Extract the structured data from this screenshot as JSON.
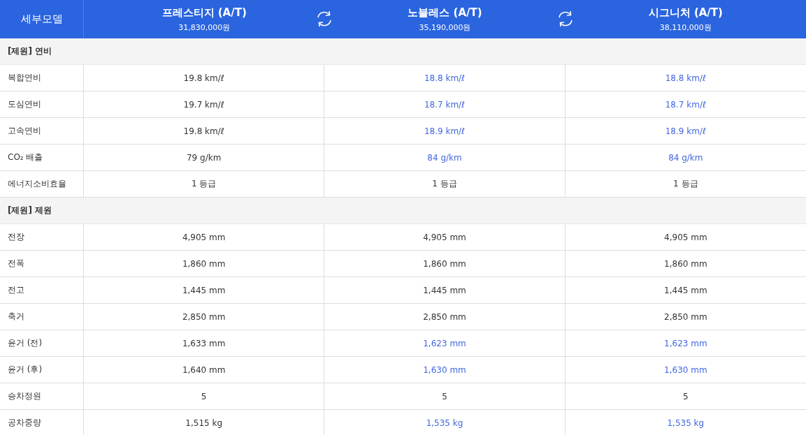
{
  "header": {
    "label": "세부모델",
    "models": [
      {
        "name": "프레스티지 (A/T)",
        "price": "31,830,000원"
      },
      {
        "name": "노블레스 (A/T)",
        "price": "35,190,000원"
      },
      {
        "name": "시그니처 (A/T)",
        "price": "38,110,000원"
      }
    ]
  },
  "sections": [
    {
      "title": "[제원] 연비",
      "rows": [
        {
          "label": "복합연비",
          "values": [
            {
              "text": "19.8 km/ℓ",
              "changed": false
            },
            {
              "text": "18.8 km/ℓ",
              "changed": true
            },
            {
              "text": "18.8 km/ℓ",
              "changed": true
            }
          ]
        },
        {
          "label": "도심연비",
          "values": [
            {
              "text": "19.7 km/ℓ",
              "changed": false
            },
            {
              "text": "18.7 km/ℓ",
              "changed": true
            },
            {
              "text": "18.7 km/ℓ",
              "changed": true
            }
          ]
        },
        {
          "label": "고속연비",
          "values": [
            {
              "text": "19.8 km/ℓ",
              "changed": false
            },
            {
              "text": "18.9 km/ℓ",
              "changed": true
            },
            {
              "text": "18.9 km/ℓ",
              "changed": true
            }
          ]
        },
        {
          "label": "CO₂ 배출",
          "values": [
            {
              "text": "79 g/km",
              "changed": false
            },
            {
              "text": "84 g/km",
              "changed": true
            },
            {
              "text": "84 g/km",
              "changed": true
            }
          ]
        },
        {
          "label": "에너지소비효율",
          "values": [
            {
              "text": "1 등급",
              "changed": false
            },
            {
              "text": "1 등급",
              "changed": false
            },
            {
              "text": "1 등급",
              "changed": false
            }
          ]
        }
      ]
    },
    {
      "title": "[제원] 제원",
      "rows": [
        {
          "label": "전장",
          "values": [
            {
              "text": "4,905 mm",
              "changed": false
            },
            {
              "text": "4,905 mm",
              "changed": false
            },
            {
              "text": "4,905 mm",
              "changed": false
            }
          ]
        },
        {
          "label": "전폭",
          "values": [
            {
              "text": "1,860 mm",
              "changed": false
            },
            {
              "text": "1,860 mm",
              "changed": false
            },
            {
              "text": "1,860 mm",
              "changed": false
            }
          ]
        },
        {
          "label": "전고",
          "values": [
            {
              "text": "1,445 mm",
              "changed": false
            },
            {
              "text": "1,445 mm",
              "changed": false
            },
            {
              "text": "1,445 mm",
              "changed": false
            }
          ]
        },
        {
          "label": "축거",
          "values": [
            {
              "text": "2,850 mm",
              "changed": false
            },
            {
              "text": "2,850 mm",
              "changed": false
            },
            {
              "text": "2,850 mm",
              "changed": false
            }
          ]
        },
        {
          "label": "윤거 (전)",
          "values": [
            {
              "text": "1,633 mm",
              "changed": false
            },
            {
              "text": "1,623 mm",
              "changed": true
            },
            {
              "text": "1,623 mm",
              "changed": true
            }
          ]
        },
        {
          "label": "윤거 (후)",
          "values": [
            {
              "text": "1,640 mm",
              "changed": false
            },
            {
              "text": "1,630 mm",
              "changed": true
            },
            {
              "text": "1,630 mm",
              "changed": true
            }
          ]
        },
        {
          "label": "승차정원",
          "values": [
            {
              "text": "5",
              "changed": false
            },
            {
              "text": "5",
              "changed": false
            },
            {
              "text": "5",
              "changed": false
            }
          ]
        },
        {
          "label": "공차중량",
          "values": [
            {
              "text": "1,515 kg",
              "changed": false
            },
            {
              "text": "1,535 kg",
              "changed": true
            },
            {
              "text": "1,535 kg",
              "changed": true
            }
          ]
        }
      ]
    }
  ]
}
